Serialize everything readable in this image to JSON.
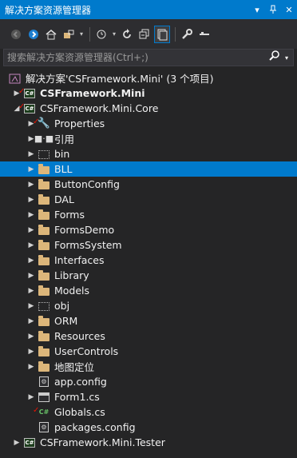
{
  "titlebar": {
    "title": "解决方案资源管理器",
    "dropdown": "▾",
    "pin": "ᵖ",
    "close": "✕"
  },
  "toolbar": {
    "icons": [
      "back-icon",
      "forward-icon",
      "home-icon",
      "switch-views-icon",
      "pending-changes-icon",
      "refresh-icon",
      "collapse-all-icon",
      "show-all-files-icon",
      "properties-icon",
      "preview-icon"
    ]
  },
  "search": {
    "placeholder": "搜索解决方案资源管理器(Ctrl+;)"
  },
  "tree": {
    "solution": "解决方案'CSFramework.Mini' (3 个项目)",
    "project1": "CSFramework.Mini",
    "project2": "CSFramework.Mini.Core",
    "items": [
      "Properties",
      "引用",
      "bin",
      "BLL",
      "ButtonConfig",
      "DAL",
      "Forms",
      "FormsDemo",
      "FormsSystem",
      "Interfaces",
      "Library",
      "Models",
      "obj",
      "ORM",
      "Resources",
      "UserControls",
      "地图定位"
    ],
    "files": [
      "app.config",
      "Form1.cs",
      "Globals.cs",
      "packages.config"
    ],
    "project3": "CSFramework.Mini.Tester",
    "selected": "BLL"
  },
  "colors": {
    "accent": "#007acc",
    "background": "#252526",
    "folder": "#dcb67a"
  }
}
